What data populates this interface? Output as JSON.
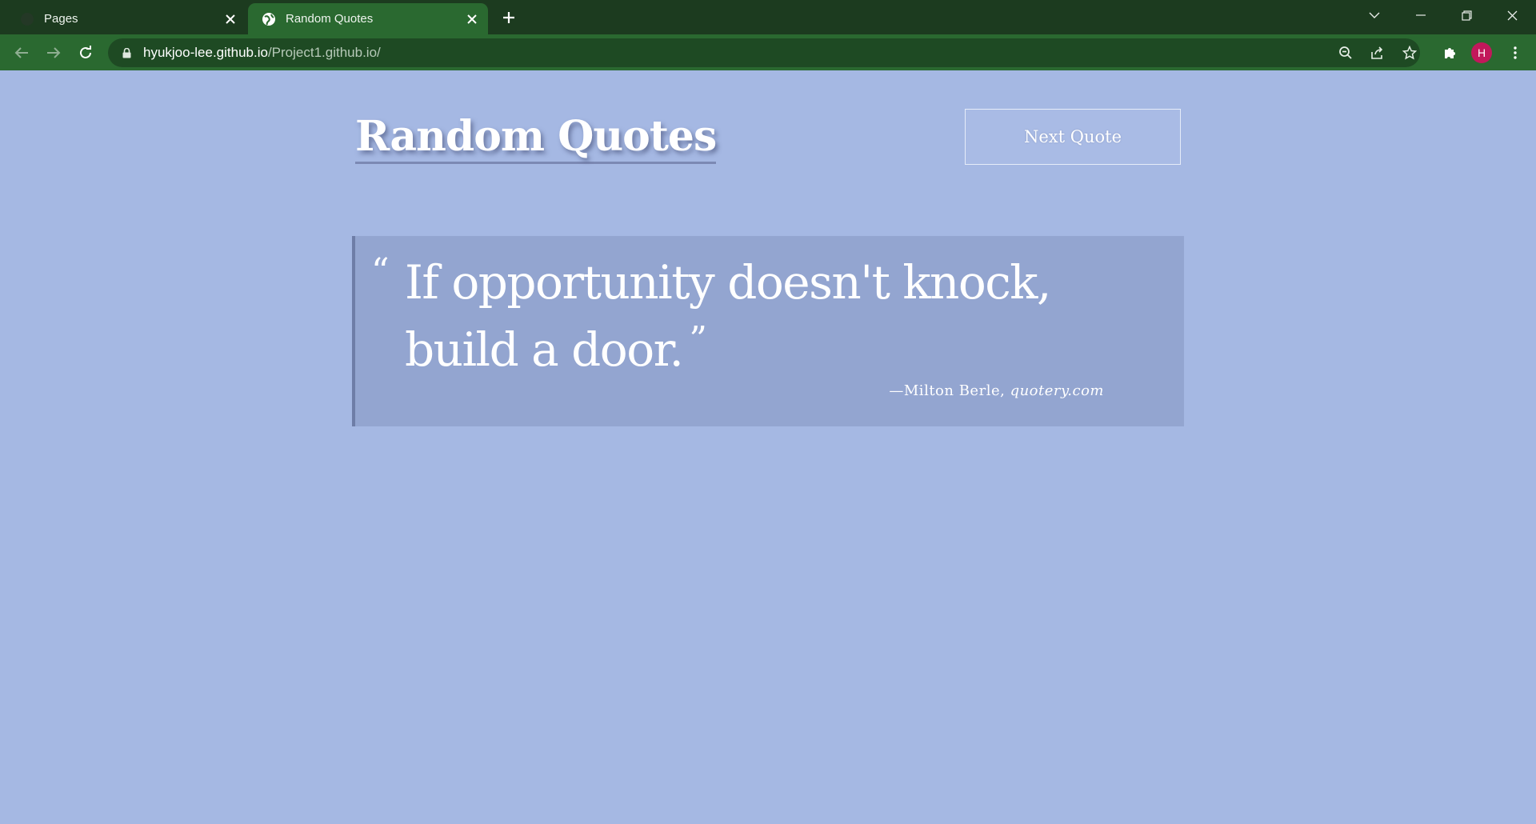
{
  "browser": {
    "tabs": [
      {
        "title": "Pages",
        "active": false,
        "favicon": "github-icon"
      },
      {
        "title": "Random Quotes",
        "active": true,
        "favicon": "globe-icon"
      }
    ],
    "url_host": "hyukjoo-lee.github.io",
    "url_path": "/Project1.github.io/",
    "profile_initial": "H",
    "profile_color": "#c2185b",
    "theme_color": "#2a6930"
  },
  "page": {
    "title": "Random Quotes",
    "next_button": "Next Quote",
    "quote": {
      "open_mark": "“",
      "text": "If opportunity doesn't knock, build a door.",
      "close_mark": "”",
      "author_prefix": "—Milton Berle,",
      "source": "quotery.com"
    },
    "background_color": "#a5b8e3"
  }
}
